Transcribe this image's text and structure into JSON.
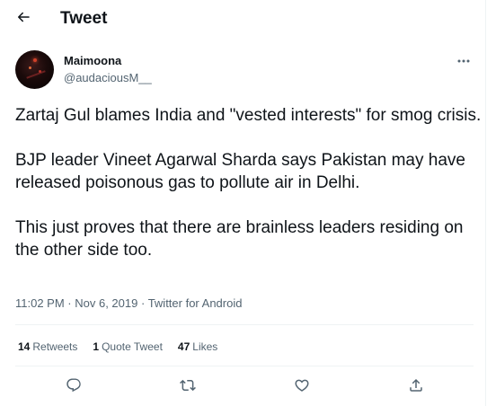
{
  "header": {
    "back_icon": "arrow-left-icon",
    "title": "Tweet"
  },
  "author": {
    "name": "Maimoona",
    "handle": "@audaciousM__",
    "avatar_icon": "profile-photo"
  },
  "more_icon": "more-dots-icon",
  "tweet": {
    "paragraphs": [
      "Zartaj Gul blames India and \"vested interests\" for smog crisis.",
      "BJP leader Vineet Agarwal Sharda says Pakistan may have released poisonous gas to pollute air in Delhi.",
      "This just proves that there are brainless leaders residing on the other side too."
    ]
  },
  "meta": {
    "time": "11:02 PM",
    "separator1": " · ",
    "date": "Nov 6, 2019",
    "separator2": " · ",
    "source": "Twitter for Android"
  },
  "stats": {
    "retweets_count": "14",
    "retweets_label": "Retweets",
    "quotes_count": "1",
    "quotes_label": "Quote Tweet",
    "likes_count": "47",
    "likes_label": "Likes"
  },
  "actions": {
    "reply_icon": "reply-icon",
    "retweet_icon": "retweet-icon",
    "like_icon": "like-icon",
    "share_icon": "share-icon"
  },
  "colors": {
    "text_primary": "#0f1419",
    "text_secondary": "#536471",
    "divider": "#eff3f4"
  }
}
